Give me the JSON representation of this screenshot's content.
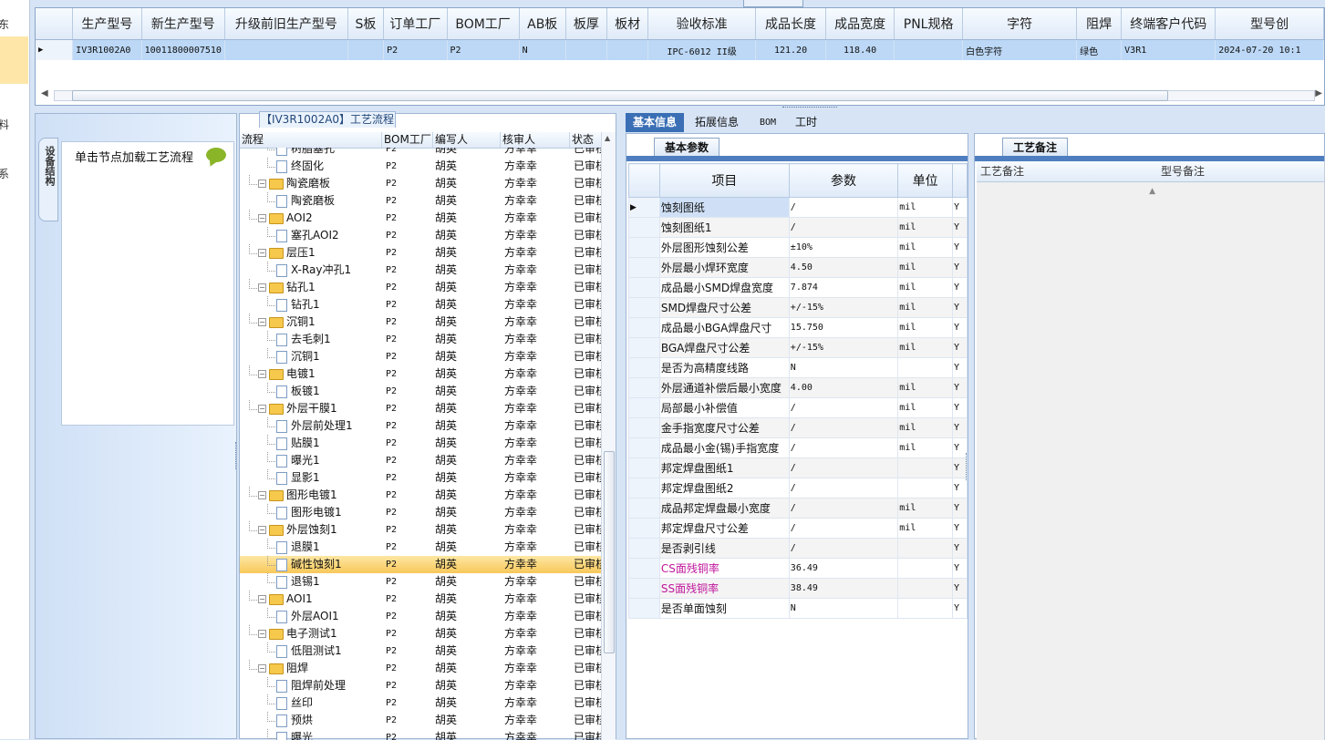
{
  "left_nav": {
    "items": [
      "东",
      "料",
      "系"
    ]
  },
  "top_grid": {
    "columns": [
      "生产型号",
      "新生产型号",
      "升级前旧生产型号",
      "S板",
      "订单工厂",
      "BOM工厂",
      "AB板",
      "板厚",
      "板材",
      "验收标准",
      "成品长度",
      "成品宽度",
      "PNL规格",
      "字符",
      "阻焊",
      "终端客户代码",
      "型号创"
    ],
    "row": [
      "IV3R1002A0",
      "10011800007510",
      "",
      "",
      "P2",
      "P2",
      "N",
      "",
      "",
      "IPC-6012 II级",
      "121.20",
      "118.40",
      "",
      "白色字符",
      "绿色",
      "V3R1",
      "2024-07-20 10:1"
    ]
  },
  "struct_panel": {
    "vertical_tab": "设备结构",
    "hint": "单击节点加载工艺流程"
  },
  "tree_panel": {
    "title": "【IV3R1002A0】工艺流程",
    "headers": [
      "流程",
      "BOM工厂",
      "编写人",
      "核审人",
      "状态"
    ],
    "rows": [
      {
        "lvl": 2,
        "name": "树脂塞孔",
        "bom": "P2",
        "w": "胡英",
        "r": "方幸幸",
        "s": "已审核"
      },
      {
        "lvl": 2,
        "name": "终固化",
        "bom": "P2",
        "w": "胡英",
        "r": "方幸幸",
        "s": "已审核"
      },
      {
        "lvl": 1,
        "name": "陶瓷磨板",
        "bom": "P2",
        "w": "胡英",
        "r": "方幸幸",
        "s": "已审核"
      },
      {
        "lvl": 2,
        "name": "陶瓷磨板",
        "bom": "P2",
        "w": "胡英",
        "r": "方幸幸",
        "s": "已审核"
      },
      {
        "lvl": 1,
        "name": "AOI2",
        "bom": "P2",
        "w": "胡英",
        "r": "方幸幸",
        "s": "已审核"
      },
      {
        "lvl": 2,
        "name": "塞孔AOI2",
        "bom": "P2",
        "w": "胡英",
        "r": "方幸幸",
        "s": "已审核"
      },
      {
        "lvl": 1,
        "name": "层压1",
        "bom": "P2",
        "w": "胡英",
        "r": "方幸幸",
        "s": "已审核"
      },
      {
        "lvl": 2,
        "name": "X-Ray冲孔1",
        "bom": "P2",
        "w": "胡英",
        "r": "方幸幸",
        "s": "已审核"
      },
      {
        "lvl": 1,
        "name": "钻孔1",
        "bom": "P2",
        "w": "胡英",
        "r": "方幸幸",
        "s": "已审核"
      },
      {
        "lvl": 2,
        "name": "钻孔1",
        "bom": "P2",
        "w": "胡英",
        "r": "方幸幸",
        "s": "已审核"
      },
      {
        "lvl": 1,
        "name": "沉铜1",
        "bom": "P2",
        "w": "胡英",
        "r": "方幸幸",
        "s": "已审核"
      },
      {
        "lvl": 2,
        "name": "去毛刺1",
        "bom": "P2",
        "w": "胡英",
        "r": "方幸幸",
        "s": "已审核"
      },
      {
        "lvl": 2,
        "name": "沉铜1",
        "bom": "P2",
        "w": "胡英",
        "r": "方幸幸",
        "s": "已审核"
      },
      {
        "lvl": 1,
        "name": "电镀1",
        "bom": "P2",
        "w": "胡英",
        "r": "方幸幸",
        "s": "已审核"
      },
      {
        "lvl": 2,
        "name": "板镀1",
        "bom": "P2",
        "w": "胡英",
        "r": "方幸幸",
        "s": "已审核"
      },
      {
        "lvl": 1,
        "name": "外层干膜1",
        "bom": "P2",
        "w": "胡英",
        "r": "方幸幸",
        "s": "已审核"
      },
      {
        "lvl": 2,
        "name": "外层前处理1",
        "bom": "P2",
        "w": "胡英",
        "r": "方幸幸",
        "s": "已审核"
      },
      {
        "lvl": 2,
        "name": "贴膜1",
        "bom": "P2",
        "w": "胡英",
        "r": "方幸幸",
        "s": "已审核"
      },
      {
        "lvl": 2,
        "name": "曝光1",
        "bom": "P2",
        "w": "胡英",
        "r": "方幸幸",
        "s": "已审核"
      },
      {
        "lvl": 2,
        "name": "显影1",
        "bom": "P2",
        "w": "胡英",
        "r": "方幸幸",
        "s": "已审核"
      },
      {
        "lvl": 1,
        "name": "图形电镀1",
        "bom": "P2",
        "w": "胡英",
        "r": "方幸幸",
        "s": "已审核"
      },
      {
        "lvl": 2,
        "name": "图形电镀1",
        "bom": "P2",
        "w": "胡英",
        "r": "方幸幸",
        "s": "已审核"
      },
      {
        "lvl": 1,
        "name": "外层蚀刻1",
        "bom": "P2",
        "w": "胡英",
        "r": "方幸幸",
        "s": "已审核"
      },
      {
        "lvl": 2,
        "name": "退膜1",
        "bom": "P2",
        "w": "胡英",
        "r": "方幸幸",
        "s": "已审核"
      },
      {
        "lvl": 2,
        "name": "碱性蚀刻1",
        "bom": "P2",
        "w": "胡英",
        "r": "方幸幸",
        "s": "已审核",
        "sel": true
      },
      {
        "lvl": 2,
        "name": "退锡1",
        "bom": "P2",
        "w": "胡英",
        "r": "方幸幸",
        "s": "已审核"
      },
      {
        "lvl": 1,
        "name": "AOI1",
        "bom": "P2",
        "w": "胡英",
        "r": "方幸幸",
        "s": "已审核"
      },
      {
        "lvl": 2,
        "name": "外层AOI1",
        "bom": "P2",
        "w": "胡英",
        "r": "方幸幸",
        "s": "已审核"
      },
      {
        "lvl": 1,
        "name": "电子测试1",
        "bom": "P2",
        "w": "胡英",
        "r": "方幸幸",
        "s": "已审核"
      },
      {
        "lvl": 2,
        "name": "低阻测试1",
        "bom": "P2",
        "w": "胡英",
        "r": "方幸幸",
        "s": "已审核"
      },
      {
        "lvl": 1,
        "name": "阻焊",
        "bom": "P2",
        "w": "胡英",
        "r": "方幸幸",
        "s": "已审核"
      },
      {
        "lvl": 2,
        "name": "阻焊前处理",
        "bom": "P2",
        "w": "胡英",
        "r": "方幸幸",
        "s": "已审核"
      },
      {
        "lvl": 2,
        "name": "丝印",
        "bom": "P2",
        "w": "胡英",
        "r": "方幸幸",
        "s": "已审核"
      },
      {
        "lvl": 2,
        "name": "预烘",
        "bom": "P2",
        "w": "胡英",
        "r": "方幸幸",
        "s": "已审核"
      },
      {
        "lvl": 2,
        "name": "曝光",
        "bom": "P2",
        "w": "胡英",
        "r": "方幸幸",
        "s": "已审核"
      }
    ]
  },
  "main_tabs": [
    "基本信息",
    "拓展信息",
    "BOM",
    "工时"
  ],
  "basic": {
    "title": "基本参数",
    "headers": [
      "项目",
      "参数",
      "单位"
    ],
    "rows": [
      {
        "item": "蚀刻图纸",
        "param": "/",
        "unit": "mil",
        "flag": "Y"
      },
      {
        "item": "蚀刻图纸1",
        "param": "/",
        "unit": "mil",
        "flag": "Y"
      },
      {
        "item": "外层图形蚀刻公差",
        "param": "±10%",
        "unit": "mil",
        "flag": "Y"
      },
      {
        "item": "外层最小焊环宽度",
        "param": "4.50",
        "unit": "mil",
        "flag": "Y"
      },
      {
        "item": "成品最小SMD焊盘宽度",
        "param": "7.874",
        "unit": "mil",
        "flag": "Y"
      },
      {
        "item": "SMD焊盘尺寸公差",
        "param": "+/-15%",
        "unit": "mil",
        "flag": "Y"
      },
      {
        "item": "成品最小BGA焊盘尺寸",
        "param": "15.750",
        "unit": "mil",
        "flag": "Y"
      },
      {
        "item": "BGA焊盘尺寸公差",
        "param": "+/-15%",
        "unit": "mil",
        "flag": "Y"
      },
      {
        "item": "是否为高精度线路",
        "param": "N",
        "unit": "",
        "flag": "Y"
      },
      {
        "item": "外层通道补偿后最小宽度",
        "param": "4.00",
        "unit": "mil",
        "flag": "Y"
      },
      {
        "item": "局部最小补偿值",
        "param": "/",
        "unit": "mil",
        "flag": "Y"
      },
      {
        "item": "金手指宽度尺寸公差",
        "param": "/",
        "unit": "mil",
        "flag": "Y"
      },
      {
        "item": "成品最小金(锡)手指宽度",
        "param": "/",
        "unit": "mil",
        "flag": "Y"
      },
      {
        "item": "邦定焊盘图纸1",
        "param": "/",
        "unit": "",
        "flag": "Y"
      },
      {
        "item": "邦定焊盘图纸2",
        "param": "/",
        "unit": "",
        "flag": "Y"
      },
      {
        "item": "成品邦定焊盘最小宽度",
        "param": "/",
        "unit": "mil",
        "flag": "Y"
      },
      {
        "item": "邦定焊盘尺寸公差",
        "param": "/",
        "unit": "mil",
        "flag": "Y"
      },
      {
        "item": "是否剥引线",
        "param": "/",
        "unit": "",
        "flag": "Y"
      },
      {
        "item": "CS面残铜率",
        "param": "36.49",
        "unit": "",
        "flag": "Y",
        "pink": true
      },
      {
        "item": "SS面残铜率",
        "param": "38.49",
        "unit": "",
        "flag": "Y",
        "pink": true
      },
      {
        "item": "是否单面蚀刻",
        "param": "N",
        "unit": "",
        "flag": "Y"
      }
    ]
  },
  "remarks": {
    "title": "工艺备注",
    "col1": "工艺备注",
    "col2": "型号备注"
  }
}
